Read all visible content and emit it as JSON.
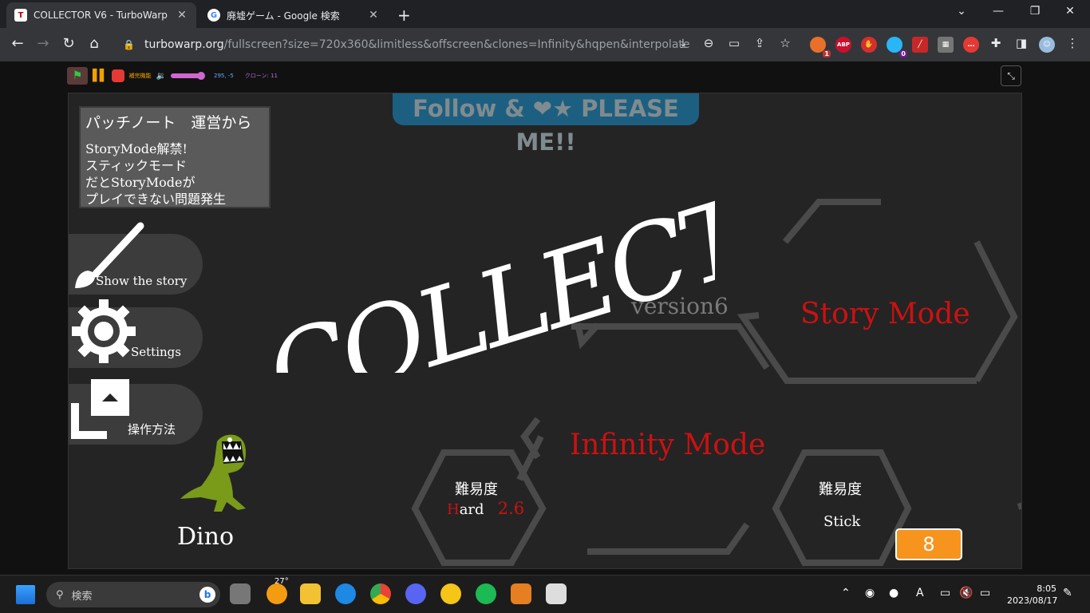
{
  "browser": {
    "tabs": [
      {
        "title": "COLLECTOR V6 - TurboWarp",
        "active": true
      },
      {
        "title": "廃墟ゲーム - Google 検索",
        "active": false
      }
    ],
    "url_host": "turbowarp.org",
    "url_path": "/fullscreen?size=720x360&limitless&offscreen&clones=Infinity&hqpen&interpolate",
    "ext_badges": {
      "first": "1",
      "second": "0",
      "abp": "ABP"
    }
  },
  "turbowarp": {
    "addon_label": "補完機能",
    "mouse_coords": "295, -5",
    "clones": "クローン: 11"
  },
  "game": {
    "patch_notes": {
      "header": "パッチノート　運営から",
      "lines": [
        "StoryMode解禁!",
        "スティックモード",
        "だとStoryModeが",
        "プレイできない問題発生"
      ]
    },
    "follow_banner": "Follow & ❤★ PLEASE ME!!",
    "title": "COLLECTOR",
    "version": "version6",
    "menu": {
      "story": "Show the story",
      "settings": "Settings",
      "controls": "操作方法"
    },
    "modes": {
      "story": "Story Mode",
      "infinity": "Infinity Mode"
    },
    "difficulty": {
      "header": "難易度",
      "hard_initial": "H",
      "hard_rest": "ard",
      "hard_value": "2.6",
      "stick": "Stick"
    },
    "counter": "8",
    "character": "Dino"
  },
  "taskbar": {
    "search_placeholder": "検索",
    "weather_temp": "27°",
    "time": "8:05",
    "date": "2023/08/17"
  },
  "colors": {
    "accent_red": "#cc1111",
    "counter_orange": "#f7941d",
    "dino_green": "#7a9a1a",
    "follow_blue": "#1d5f80"
  }
}
